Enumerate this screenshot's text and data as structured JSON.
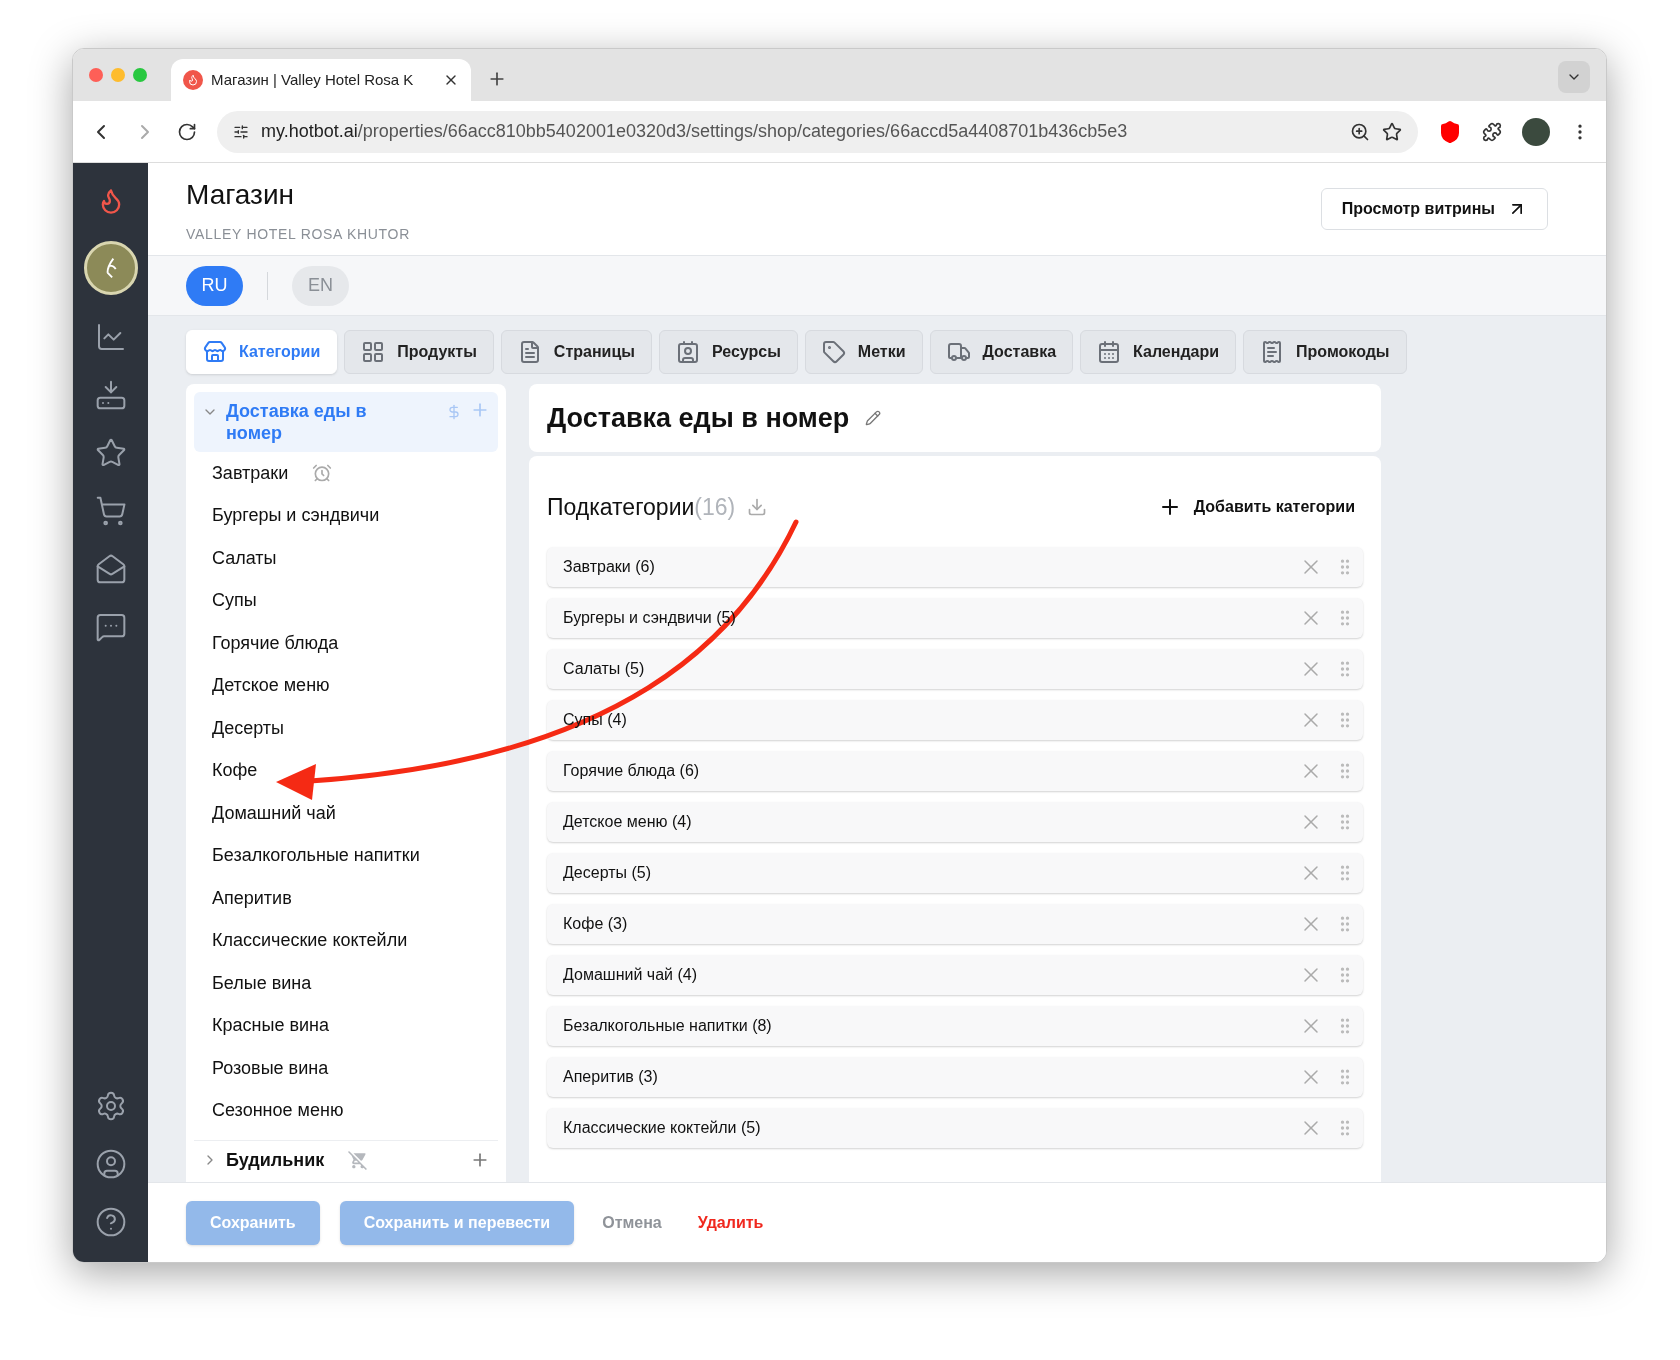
{
  "browser": {
    "tab_title": "Магазин | Valley Hotel Rosa K",
    "url_host": "my.hotbot.ai",
    "url_path": "/properties/66acc810bb5402001e0320d3/settings/shop/categories/66accd5a4408701b436cb5e3"
  },
  "header": {
    "title": "Магазин",
    "subtitle": "VALLEY HOTEL ROSA KHUTOR",
    "storefront_button": "Просмотр витрины"
  },
  "languages": [
    {
      "label": "RU",
      "selected": true
    },
    {
      "label": "EN",
      "selected": false
    }
  ],
  "tabs": [
    {
      "label": "Категории",
      "selected": true
    },
    {
      "label": "Продукты",
      "selected": false
    },
    {
      "label": "Страницы",
      "selected": false
    },
    {
      "label": "Ресурсы",
      "selected": false
    },
    {
      "label": "Метки",
      "selected": false
    },
    {
      "label": "Доставка",
      "selected": false
    },
    {
      "label": "Календари",
      "selected": false
    },
    {
      "label": "Промокоды",
      "selected": false
    }
  ],
  "tree": [
    {
      "label": "Доставка еды в номер",
      "selected": true,
      "expanded": true,
      "purchasable": true,
      "children": [
        {
          "label": "Завтраки",
          "scheduled": true
        },
        {
          "label": "Бургеры и сэндвичи",
          "scheduled": false
        },
        {
          "label": "Салаты",
          "scheduled": false
        },
        {
          "label": "Супы",
          "scheduled": false
        },
        {
          "label": "Горячие блюда",
          "scheduled": false
        },
        {
          "label": "Детское меню",
          "scheduled": false
        },
        {
          "label": "Десерты",
          "scheduled": false
        },
        {
          "label": "Кофе",
          "scheduled": false
        },
        {
          "label": "Домашний чай",
          "scheduled": false
        },
        {
          "label": "Безалкогольные напитки",
          "scheduled": false
        },
        {
          "label": "Аперитив",
          "scheduled": false
        },
        {
          "label": "Классические коктейли",
          "scheduled": false
        },
        {
          "label": "Белые вина",
          "scheduled": false
        },
        {
          "label": "Красные вина",
          "scheduled": false
        },
        {
          "label": "Розовые вина",
          "scheduled": false
        },
        {
          "label": "Сезонное меню",
          "scheduled": false
        }
      ]
    },
    {
      "label": "Будильник",
      "selected": false,
      "expanded": false,
      "purchasable": false
    }
  ],
  "category": {
    "title": "Доставка еды в номер",
    "subcategories_label": "Подкатегории",
    "subcategories_count": "(16)",
    "add_button": "Добавить категории",
    "rows": [
      "Завтраки (6)",
      "Бургеры и сэндвичи (5)",
      "Салаты (5)",
      "Супы (4)",
      "Горячие блюда (6)",
      "Детское меню (4)",
      "Десерты (5)",
      "Кофе (3)",
      "Домашний чай (4)",
      "Безалкогольные напитки (8)",
      "Аперитив (3)",
      "Классические коктейли (5)"
    ]
  },
  "footer": [
    {
      "label": "Сохранить",
      "kind": "primary",
      "disabled": true
    },
    {
      "label": "Сохранить и перевести",
      "kind": "primary",
      "disabled": true
    },
    {
      "label": "Отмена",
      "kind": "link",
      "disabled": false
    },
    {
      "label": "Удалить",
      "kind": "danger",
      "disabled": false
    }
  ]
}
